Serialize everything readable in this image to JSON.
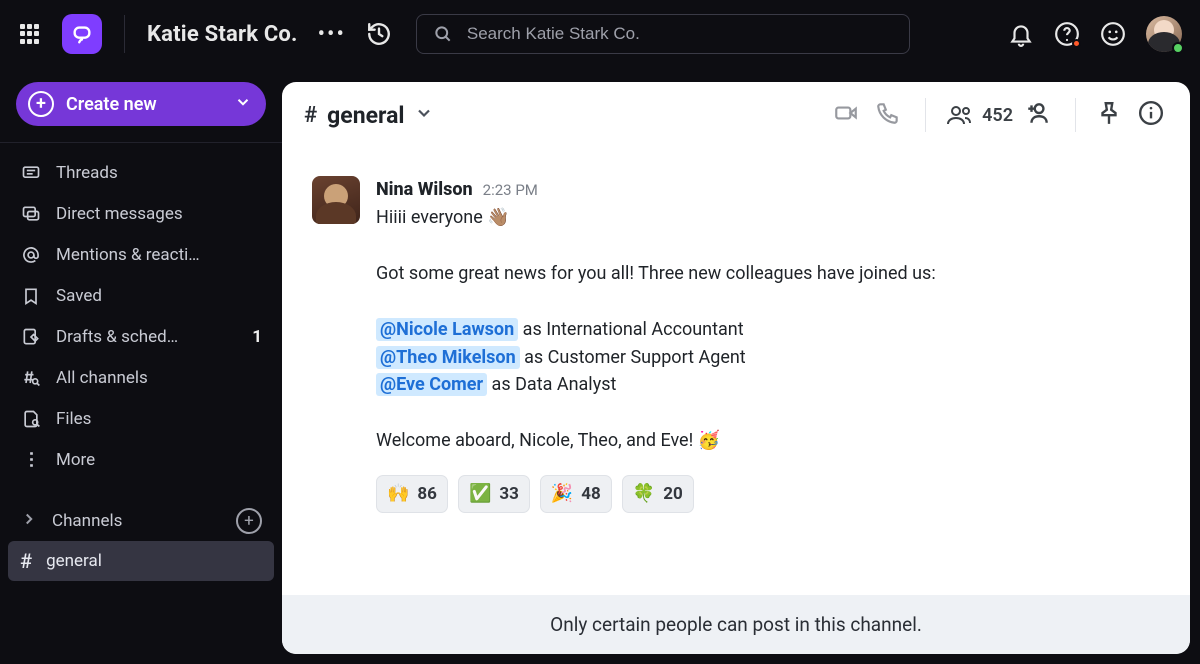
{
  "workspace": {
    "name": "Katie Stark Co."
  },
  "search": {
    "placeholder": "Search Katie Stark Co."
  },
  "create_button": {
    "label": "Create new"
  },
  "nav": {
    "threads": "Threads",
    "dm": "Direct messages",
    "mentions": "Mentions & reacti…",
    "saved": "Saved",
    "drafts": "Drafts & sched…",
    "drafts_badge": "1",
    "all_channels": "All channels",
    "files": "Files",
    "more": "More"
  },
  "channels_section": {
    "label": "Channels",
    "items": [
      {
        "hash": "#",
        "name": "general",
        "active": true
      }
    ]
  },
  "channel_header": {
    "hash": "#",
    "name": "general",
    "member_count": "452"
  },
  "message": {
    "author": "Nina Wilson",
    "time": "2:23 PM",
    "line1_prefix": "Hiiii everyone ",
    "line1_emoji": "👋🏽",
    "line2": "Got some great news for you all! Three new colleagues have joined us:",
    "mention1": "@Nicole Lawson",
    "role1": "  as International Accountant",
    "mention2": "@Theo Mikelson",
    "role2": "  as Customer Support Agent",
    "mention3": "@Eve Comer",
    "role3": "  as Data Analyst",
    "closing_prefix": "Welcome aboard, Nicole, Theo, and Eve! ",
    "closing_emoji": "🥳"
  },
  "reactions": [
    {
      "emoji": "🙌",
      "count": "86"
    },
    {
      "emoji": "✅",
      "count": "33"
    },
    {
      "emoji": "🎉",
      "count": "48"
    },
    {
      "emoji": "🍀",
      "count": "20"
    }
  ],
  "banner": "Only certain people can post in this channel."
}
